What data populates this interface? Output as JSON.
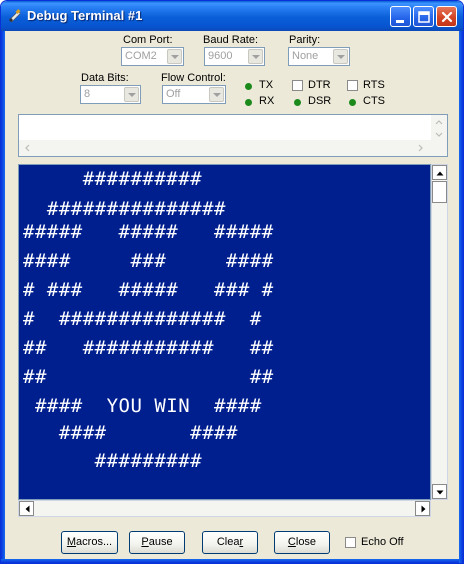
{
  "window": {
    "title": "Debug Terminal #1"
  },
  "settings": {
    "com_port": {
      "label": "Com Port:",
      "value": "COM2"
    },
    "baud_rate": {
      "label": "Baud Rate:",
      "value": "9600"
    },
    "parity": {
      "label": "Parity:",
      "value": "None"
    },
    "data_bits": {
      "label": "Data Bits:",
      "value": "8"
    },
    "flow_control": {
      "label": "Flow Control:",
      "value": "Off"
    }
  },
  "indicators": {
    "tx": "TX",
    "rx": "RX",
    "dtr": "DTR",
    "rts": "RTS",
    "dsr": "DSR",
    "cts": "CTS"
  },
  "terminal": {
    "lines": [
      "     ##########",
      "  ###############",
      "#####   #####   #####",
      "####     ###     ####",
      "# ###   #####   ### #",
      "#  ##############  #",
      "##   ###########   ##",
      "##                 ##",
      " ####  YOU WIN  ####",
      "   ####       ####",
      "      #########"
    ]
  },
  "buttons": {
    "macros": {
      "accel": "M",
      "rest": "acros..."
    },
    "pause": {
      "accel": "P",
      "rest": "ause"
    },
    "clear": {
      "pre": "Clea",
      "accel": "r"
    },
    "close": {
      "accel": "C",
      "rest": "lose"
    },
    "echo_off": "Echo Off"
  },
  "colors": {
    "terminal_bg": "#001f8f",
    "terminal_text": "#ffffff",
    "led_green": "#1b8a1b",
    "titlebar": "#0a5fd8"
  }
}
